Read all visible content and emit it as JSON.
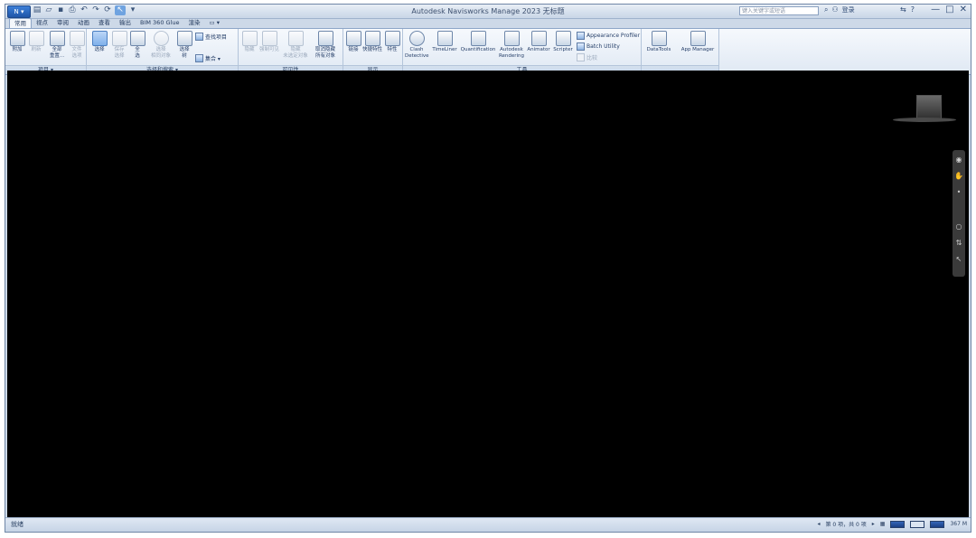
{
  "titlebar": {
    "app_button": "N ▾",
    "title": "Autodesk Navisworks Manage 2023    无标题",
    "search_placeholder": "键入关键字或短语",
    "login": "登录",
    "win_controls": [
      "—",
      "□",
      "✕"
    ]
  },
  "tabs": [
    "常用",
    "视点",
    "审阅",
    "动画",
    "查看",
    "输出",
    "BIM 360 Glue",
    "渲染",
    "▭ ▾"
  ],
  "ribbon": {
    "panels": {
      "project": {
        "label": "项目 ▾",
        "buttons": [
          "附加",
          "刷新",
          "全部\n重置...",
          "文件\n选项"
        ]
      },
      "select_search": {
        "label": "选择和搜索 ▾",
        "buttons": [
          "选择",
          "保存\n选择",
          "全\n选",
          "选择\n相同对象",
          "选择\n树"
        ],
        "small": [
          "查找项目",
          "集合 ▾"
        ]
      },
      "visibility": {
        "label": "可见性",
        "buttons": [
          "隐藏",
          "强制可见",
          "隐藏\n未选定对象",
          "取消隐藏\n所有对象"
        ]
      },
      "display": {
        "label": "显示",
        "buttons": [
          "链接",
          "快捷特性",
          "特性"
        ]
      },
      "tools": {
        "label": "工具",
        "buttons": [
          "Clash\nDetective",
          "TimeLiner",
          "Quantification",
          "Autodesk\nRendering",
          "Animator",
          "Scripter"
        ],
        "small": [
          "Appearance Profiler",
          "Batch Utility",
          "比较"
        ]
      },
      "extras": {
        "buttons": [
          "DataTools",
          "App Manager"
        ]
      }
    }
  },
  "status": {
    "left": "就绪",
    "pager": "第 0 项，共 0 项",
    "memory": "367 M"
  }
}
